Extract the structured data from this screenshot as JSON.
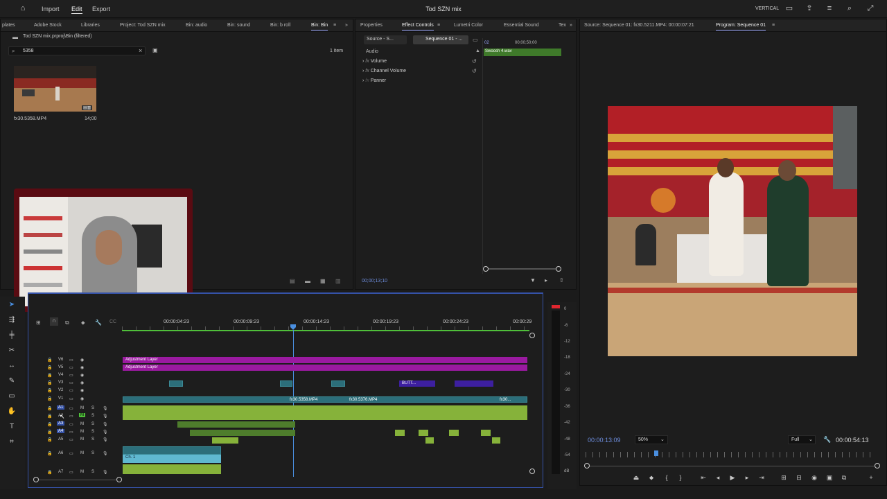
{
  "app": {
    "title": "Tod SZN mix",
    "workspace": "VERTICAL"
  },
  "menu": {
    "import": "Import",
    "edit": "Edit",
    "export": "Export"
  },
  "project_panel": {
    "tabs": [
      "plates",
      "Adobe Stock",
      "Libraries",
      "Project: Tod SZN mix",
      "Bin: audio",
      "Bin: sound",
      "Bin: b roll",
      "Bin: Bin"
    ],
    "path": "Tod SZN mix.prproj\\Bin (filtered)",
    "search_value": "5358",
    "item_count": "1 item",
    "clip_name": "fx30.5358.MP4",
    "clip_duration": "14;00"
  },
  "effect_panel": {
    "tabs": [
      "Properties",
      "Effect Controls",
      "Lumetri Color",
      "Essential Sound",
      "Tex"
    ],
    "source_label": "Source - S...",
    "sequence_label": "Sequence 01 - ...",
    "section": "Audio",
    "effects": [
      "Volume",
      "Channel Volume",
      "Panner"
    ],
    "clip_label": "Swoosh 4.wav",
    "ruler_time": "00;00;50;00",
    "ruler_start": "02",
    "timecode": "00;00;13;10"
  },
  "program_panel": {
    "source_tab": "Source: Sequence 01: fx30.5211.MP4: 00:00:07:21",
    "program_tab": "Program: Sequence 01",
    "timecode_current": "00:00:13:09",
    "zoom": "50%",
    "quality": "Full",
    "timecode_total": "00:00:54:13"
  },
  "timeline": {
    "ruler_labels": [
      "00:00:04:23",
      "00:00:09:23",
      "00:00:14:23",
      "00:00:19:23",
      "00:00:24:23",
      "00:00:29"
    ],
    "video_tracks": [
      "V6",
      "V5",
      "V4",
      "V3",
      "V2",
      "V1"
    ],
    "audio_tracks": [
      "A1",
      "A2",
      "A3",
      "A4",
      "A5",
      "A6",
      "A7"
    ],
    "adjustment_layer_1": "Adjustment Layer",
    "adjustment_layer_2": "Adjustment Layer",
    "v1_clip_1": "fx30.5358.MP4",
    "v1_clip_2": "fx30.5376.MP4",
    "v1_clip_3": "fx30...",
    "v3_clip": "BUTT...",
    "a6_clip": "Ch. 1",
    "fx_marker": "fx"
  },
  "meter": {
    "scale": [
      "0",
      "-6",
      "-12",
      "-18",
      "-24",
      "-30",
      "-36",
      "-42",
      "-48",
      "-54",
      "dB"
    ]
  },
  "colors": {
    "accent": "#9aa7ff",
    "adjustment": "#9a1aa0",
    "audio": "#86b23a",
    "video": "#2c6e7a",
    "playhead": "#4a8fe0"
  }
}
